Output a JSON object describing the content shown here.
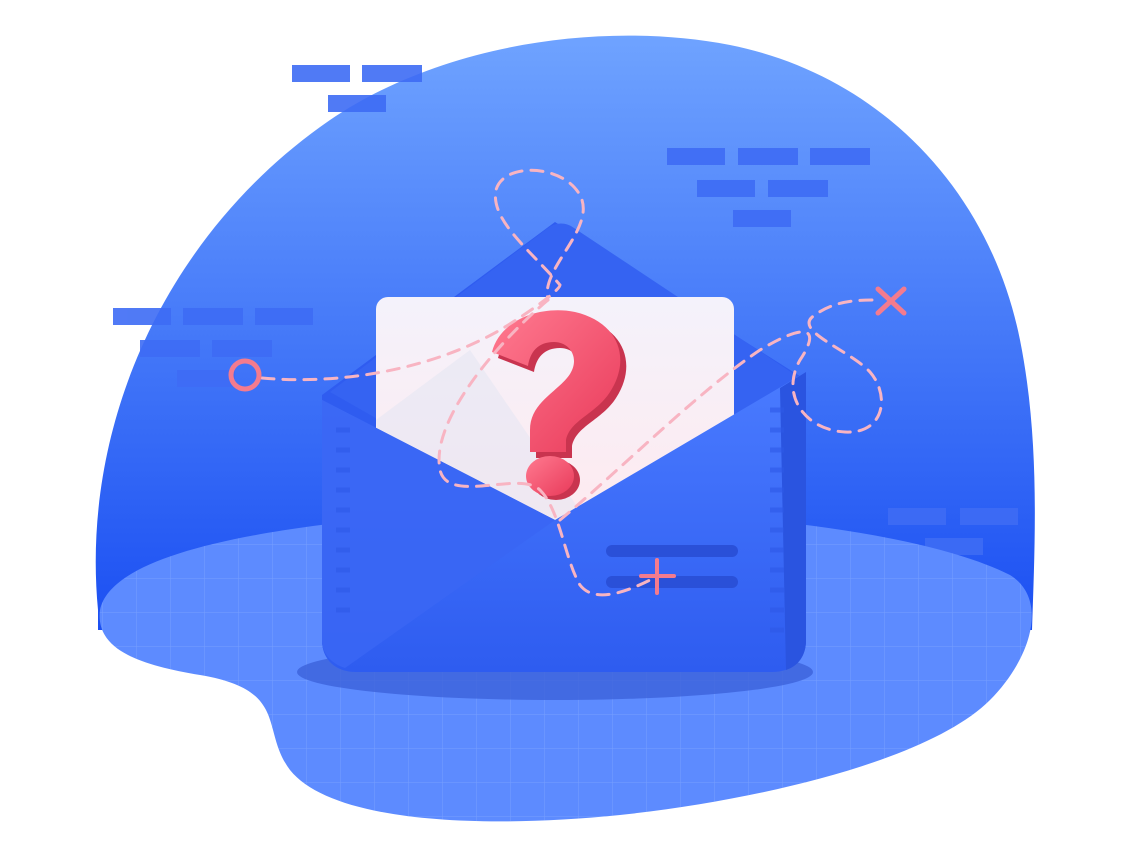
{
  "illustration": {
    "subject": "envelope-question-mark",
    "colors": {
      "background": "#ffffff",
      "blob_top": "#6fa3ff",
      "blob_bottom": "#1b4ff2",
      "floor": "#5d8bff",
      "floor_grid": "#7ea3ff",
      "brick": "#3e6cf5",
      "envelope_back": "#3563f2",
      "envelope_front": "#3d6cfa",
      "envelope_edge": "#2a54e0",
      "letter_top": "#f4f2fb",
      "letter_bottom": "#ffe9ee",
      "question_mark": "#f4536f",
      "path_dash": "#f8b4c2",
      "marker": "#f47b8e",
      "shadow": "#3a5fd8"
    },
    "icons": [
      "question-mark-icon",
      "circle-start-marker-icon",
      "x-end-marker-icon",
      "plus-sparkle-icon"
    ]
  }
}
